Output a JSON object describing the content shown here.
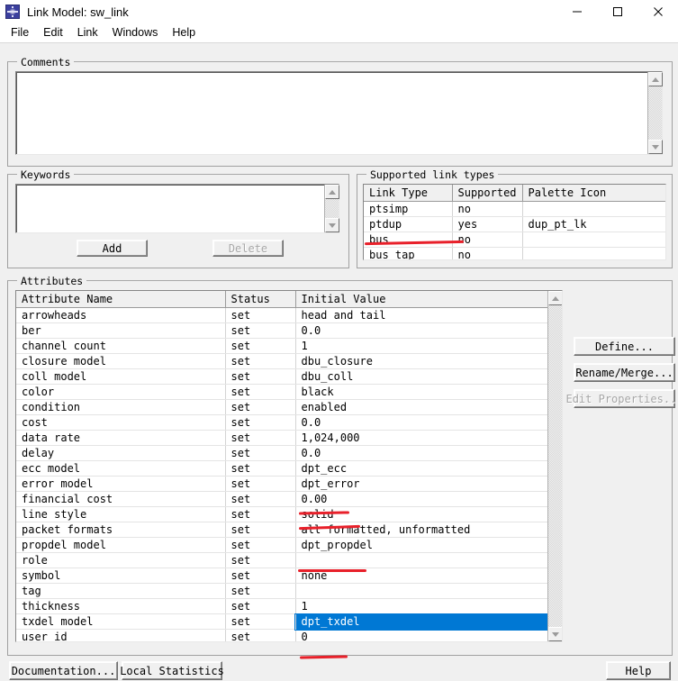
{
  "window": {
    "title": "Link Model: sw_link",
    "app_icon": "starburst-icon",
    "minimize_label": "–",
    "maximize_label": "□",
    "close_label": "✕"
  },
  "menubar": {
    "items": [
      {
        "label": "File"
      },
      {
        "label": "Edit"
      },
      {
        "label": "Link"
      },
      {
        "label": "Windows"
      },
      {
        "label": "Help"
      }
    ]
  },
  "comments": {
    "legend": "Comments",
    "value": "",
    "scroll_up_icon": "triangle-up-icon",
    "scroll_down_icon": "triangle-down-icon"
  },
  "keywords": {
    "legend": "Keywords",
    "items": [],
    "add_label": "Add",
    "delete_label": "Delete",
    "delete_disabled": true,
    "scroll_up_icon": "triangle-up-icon",
    "scroll_down_icon": "triangle-down-icon"
  },
  "supported_link_types": {
    "legend": "Supported link types",
    "columns": [
      "Link Type",
      "Supported",
      "Palette Icon"
    ],
    "rows": [
      {
        "link_type": "ptsimp",
        "supported": "no",
        "palette_icon": ""
      },
      {
        "link_type": "ptdup",
        "supported": "yes",
        "palette_icon": "dup_pt_lk"
      },
      {
        "link_type": "bus",
        "supported": "no",
        "palette_icon": ""
      },
      {
        "link_type": "bus tap",
        "supported": "no",
        "palette_icon": ""
      }
    ]
  },
  "attributes": {
    "legend": "Attributes",
    "columns": [
      "Attribute Name",
      "Status",
      "Initial Value"
    ],
    "rows": [
      {
        "name": "arrowheads",
        "status": "set",
        "value": "head and tail"
      },
      {
        "name": "ber",
        "status": "set",
        "value": "0.0"
      },
      {
        "name": "channel count",
        "status": "set",
        "value": "1"
      },
      {
        "name": "closure model",
        "status": "set",
        "value": "dbu_closure"
      },
      {
        "name": "coll model",
        "status": "set",
        "value": "dbu_coll"
      },
      {
        "name": "color",
        "status": "set",
        "value": "black"
      },
      {
        "name": "condition",
        "status": "set",
        "value": "enabled"
      },
      {
        "name": "cost",
        "status": "set",
        "value": "0.0"
      },
      {
        "name": "data rate",
        "status": "set",
        "value": "1,024,000"
      },
      {
        "name": "delay",
        "status": "set",
        "value": "0.0"
      },
      {
        "name": "ecc model",
        "status": "set",
        "value": "dpt_ecc"
      },
      {
        "name": "error model",
        "status": "set",
        "value": "dpt_error"
      },
      {
        "name": "financial cost",
        "status": "set",
        "value": "0.00"
      },
      {
        "name": "line style",
        "status": "set",
        "value": "solid"
      },
      {
        "name": "packet formats",
        "status": "set",
        "value": "all formatted, unformatted"
      },
      {
        "name": "propdel model",
        "status": "set",
        "value": "dpt_propdel"
      },
      {
        "name": "role",
        "status": "set",
        "value": ""
      },
      {
        "name": "symbol",
        "status": "set",
        "value": "none"
      },
      {
        "name": "tag",
        "status": "set",
        "value": ""
      },
      {
        "name": "thickness",
        "status": "set",
        "value": "1"
      },
      {
        "name": "txdel model",
        "status": "set",
        "value": "dpt_txdel",
        "selected": true
      },
      {
        "name": "user id",
        "status": "set",
        "value": "0"
      }
    ],
    "buttons": {
      "define_label": "Define...",
      "rename_merge_label": "Rename/Merge...",
      "edit_properties_label": "Edit Properties...",
      "edit_properties_disabled": true
    },
    "scroll_up_icon": "triangle-up-icon",
    "scroll_down_icon": "triangle-down-icon"
  },
  "footer": {
    "documentation_label": "Documentation...",
    "local_statistics_label": "Local Statistics",
    "help_label": "Help"
  },
  "annotations": {
    "color": "#e8202a",
    "marks": [
      {
        "target": "ptdup-link-type"
      },
      {
        "target": "ecc-model-value"
      },
      {
        "target": "error-model-value"
      },
      {
        "target": "propdel-model-value"
      },
      {
        "target": "txdel-model-value"
      }
    ]
  }
}
